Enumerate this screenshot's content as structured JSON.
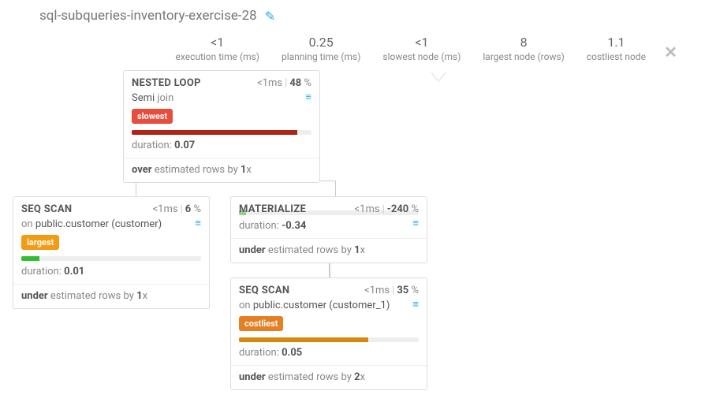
{
  "title": "sql-subqueries-inventory-exercise-28",
  "stats": [
    {
      "value": "<1",
      "label": "execution time (ms)"
    },
    {
      "value": "0.25",
      "label": "planning time (ms)"
    },
    {
      "value": "<1",
      "label": "slowest node (ms)"
    },
    {
      "value": "8",
      "label": "largest node (rows)"
    },
    {
      "value": "1.1",
      "label": "costliest node"
    }
  ],
  "nodes": {
    "n1": {
      "name": "NESTED LOOP",
      "time": "<1ms",
      "pct": "48",
      "pctSuffix": " %",
      "sub1": "Semi ",
      "sub2": "join",
      "tag": "slowest",
      "tagClass": "t-slow",
      "barColor": "#b02418",
      "barWidth": "92%",
      "durLabel": "duration: ",
      "durVal": "0.07",
      "estWord": "over",
      "estMid": " estimated rows by ",
      "estX": "1",
      "estSuffix": "x"
    },
    "n2": {
      "name": "SEQ SCAN",
      "time": "<1ms",
      "pct": "6",
      "pctSuffix": " %",
      "sub1": "on ",
      "sub2": "public.customer (customer)",
      "tag": "largest",
      "tagClass": "t-large",
      "barColor": "#2fbf2f",
      "barWidth": "10%",
      "durLabel": "duration: ",
      "durVal": "0.01",
      "estWord": "under",
      "estMid": " estimated rows by ",
      "estX": "1",
      "estSuffix": "x"
    },
    "n3": {
      "name": "MATERIALIZE",
      "time": "<1ms",
      "pct": "-240",
      "pctSuffix": " %",
      "barColor": "#8fcf8f",
      "barWidth": "4%",
      "durLabel": "duration: ",
      "durVal": "-0.34",
      "estWord": "under",
      "estMid": " estimated rows by ",
      "estX": "1",
      "estSuffix": "x"
    },
    "n4": {
      "name": "SEQ SCAN",
      "time": "<1ms",
      "pct": "35",
      "pctSuffix": " %",
      "sub1": "on ",
      "sub2": "public.customer (customer_1)",
      "tag": "costliest",
      "tagClass": "t-cost",
      "barColor": "#d68a10",
      "barWidth": "72%",
      "durLabel": "duration: ",
      "durVal": "0.05",
      "estWord": "under",
      "estMid": " estimated rows by ",
      "estX": "2",
      "estSuffix": "x"
    }
  }
}
